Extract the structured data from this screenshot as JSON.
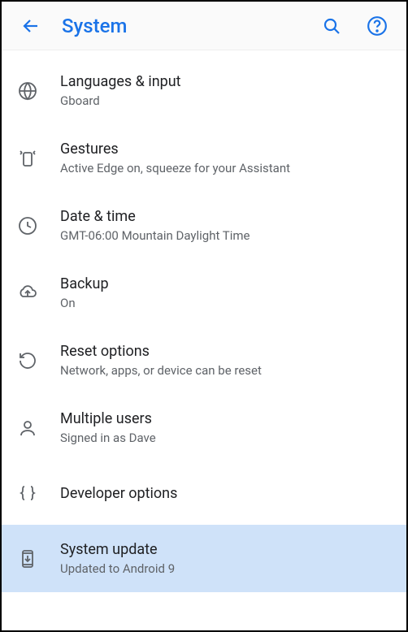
{
  "header": {
    "title": "System"
  },
  "items": [
    {
      "title": "Languages & input",
      "subtitle": "Gboard"
    },
    {
      "title": "Gestures",
      "subtitle": "Active Edge on, squeeze for your Assistant"
    },
    {
      "title": "Date & time",
      "subtitle": "GMT-06:00 Mountain Daylight Time"
    },
    {
      "title": "Backup",
      "subtitle": "On"
    },
    {
      "title": "Reset options",
      "subtitle": "Network, apps, or device can be reset"
    },
    {
      "title": "Multiple users",
      "subtitle": "Signed in as Dave"
    },
    {
      "title": "Developer options",
      "subtitle": ""
    },
    {
      "title": "System update",
      "subtitle": "Updated to Android 9"
    }
  ]
}
